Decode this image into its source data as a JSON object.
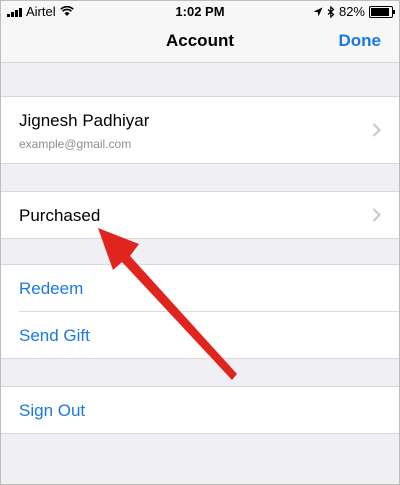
{
  "status_bar": {
    "carrier": "Airtel",
    "time": "1:02 PM",
    "battery": "82%",
    "icons": [
      "signal-icon",
      "wifi-icon",
      "location-icon",
      "bluetooth-icon",
      "battery-icon"
    ]
  },
  "navbar": {
    "title": "Account",
    "done_label": "Done"
  },
  "profile": {
    "name": "Jignesh Padhiyar",
    "email": "example@gmail.com"
  },
  "menu": {
    "purchased": "Purchased",
    "redeem": "Redeem",
    "send_gift": "Send Gift",
    "sign_out": "Sign Out"
  },
  "colors": {
    "accent": "#1a78e6",
    "annotation_arrow": "#e0241e",
    "background": "#efeff4"
  }
}
